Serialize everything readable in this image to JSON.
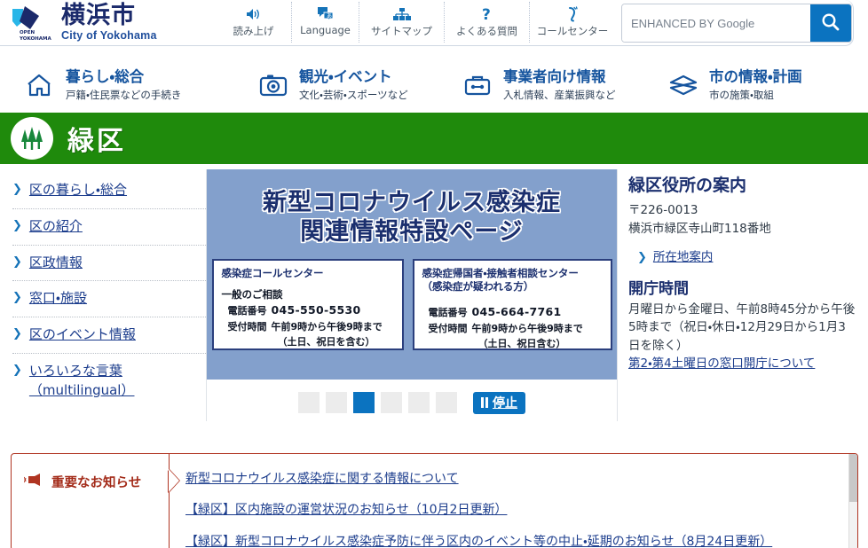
{
  "header": {
    "logo_ja": "横浜市",
    "logo_en": "City of Yokohama",
    "logo_badge_line1": "OPEN",
    "logo_badge_line2": "YOKOHAMA",
    "utility": [
      {
        "label": "読み上げ",
        "icon": "speaker-icon"
      },
      {
        "label": "Language",
        "icon": "language-icon"
      },
      {
        "label": "サイトマップ",
        "icon": "sitemap-icon"
      },
      {
        "label": "よくある質問",
        "icon": "question-icon"
      },
      {
        "label": "コールセンター",
        "icon": "phone-icon"
      }
    ],
    "search": {
      "placeholder": "ENHANCED BY Google",
      "value": "",
      "button_icon": "search-icon"
    }
  },
  "categories": [
    {
      "icon": "house-icon",
      "title": "暮らし・総合",
      "sub": "戸籍・住民票などの手続き"
    },
    {
      "icon": "camera-icon",
      "title": "観光・イベント",
      "sub": "文化・芸術・スポーツなど"
    },
    {
      "icon": "briefcase-icon",
      "title": "事業者向け情報",
      "sub": "入札情報、産業振興など"
    },
    {
      "icon": "diamond-icon",
      "title": "市の情報・計画",
      "sub": "市の施策・取組"
    }
  ],
  "ward": {
    "name": "緑区",
    "badge_icon": "midori-trees-icon",
    "bar_color": "#1f8a0c"
  },
  "sidebar": {
    "items": [
      {
        "label": "区の暮らし・総合"
      },
      {
        "label": "区の紹介"
      },
      {
        "label": "区政情報"
      },
      {
        "label": "窓口・施設"
      },
      {
        "label": "区のイベント情報"
      },
      {
        "label": "いろいろな言葉\n（multilingual）"
      }
    ]
  },
  "banner": {
    "background_color": "#83a0cc",
    "title_line1": "新型コロナウイルス感染症",
    "title_line2": "関連情報特設ページ",
    "card_left": {
      "heading": "感染症コールセンター",
      "subheading": "一般のご相談",
      "phone_label": "電話番号",
      "phone_value": "045-550-5530",
      "hours_label": "受付時間",
      "hours_value": "午前9時から午後9時まで",
      "note": "（土日、祝日を含む）"
    },
    "card_right": {
      "heading_line1": "感染症帰国者・接触者相談センター",
      "heading_line2": "（感染症が疑われる方）",
      "phone_label": "電話番号",
      "phone_value": "045-664-7761",
      "hours_label": "受付時間",
      "hours_value": "午前9時から午後9時まで",
      "note": "（土日、祝日含む）"
    },
    "carousel": {
      "slide_count": 6,
      "active_index": 3,
      "stop_label": "停止",
      "stop_icon": "pause-icon"
    }
  },
  "info_panel": {
    "title": "緑区役所の案内",
    "postal_code": "〒226-0013",
    "address": "横浜市緑区寺山町118番地",
    "map_link": "所在地案内",
    "hours_title": "開庁時間",
    "hours_body": "月曜日から金曜日、午前8時45分から午後5時まで（祝日・休日・12月29日から1月3日を除く）",
    "saturday_link": "第2・第4土曜日の窓口開庁について"
  },
  "notices": {
    "label": "重要なお知らせ",
    "icon": "megaphone-icon",
    "accent_color": "#a32b19",
    "items": [
      {
        "text": "新型コロナウイルス感染症に関する情報について"
      },
      {
        "text": "【緑区】区内施設の運営状況のお知らせ（10月2日更新）"
      },
      {
        "text": "【緑区】新型コロナウイルス感染症予防に伴う区内のイベント等の中止・延期のお知らせ（8月24日更新）"
      }
    ]
  }
}
